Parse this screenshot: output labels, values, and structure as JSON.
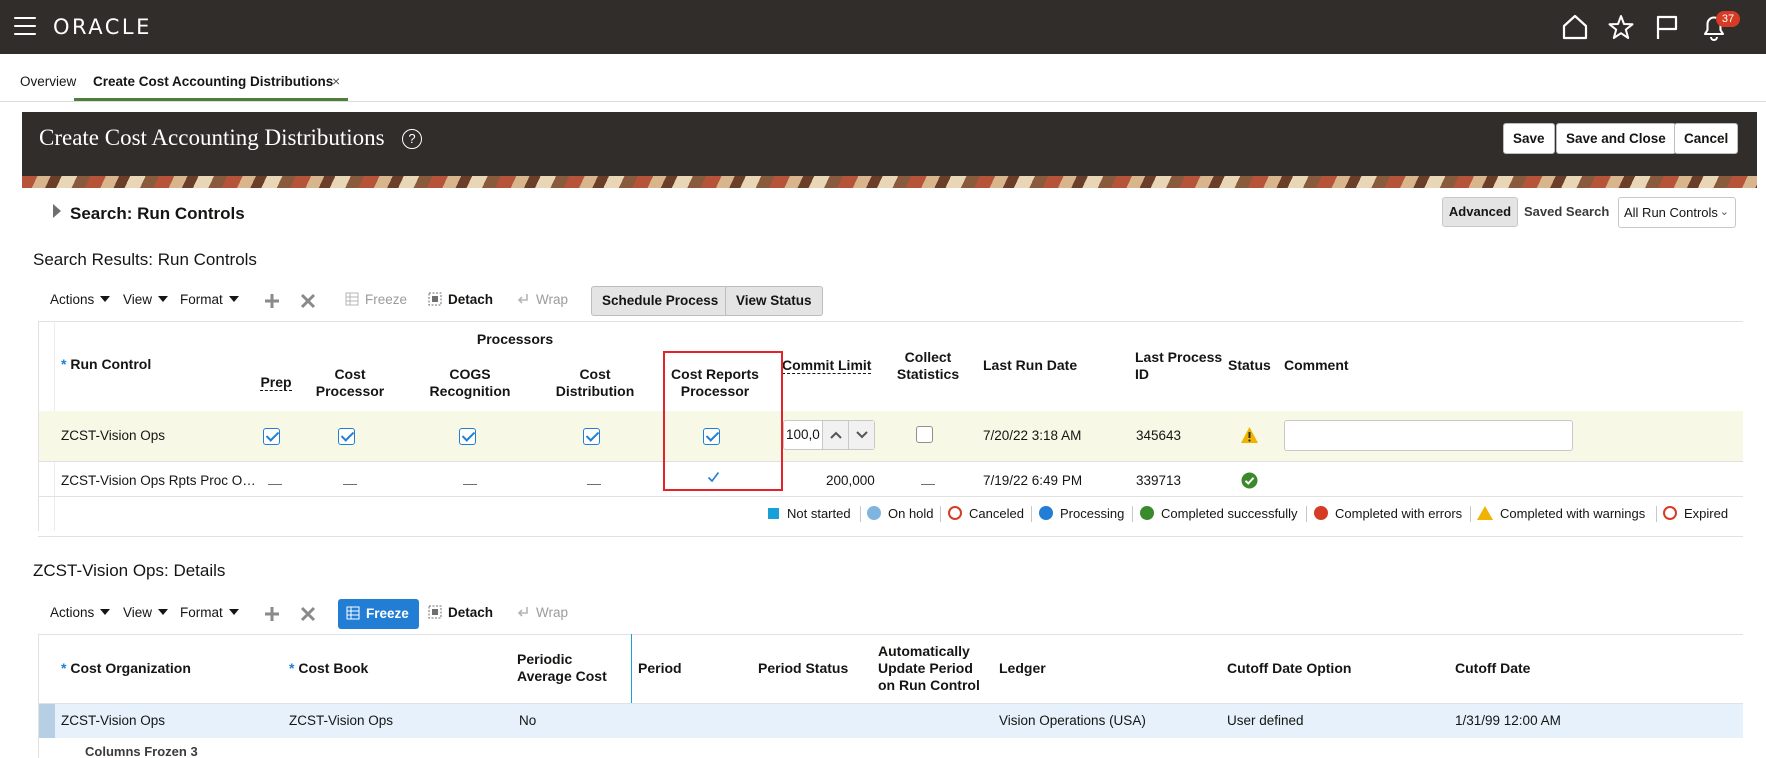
{
  "app": {
    "logo": "ORACLE",
    "notification_count": "37",
    "icons": [
      "home-icon",
      "favorites-icon",
      "watchlist-flag-icon",
      "notifications-bell-icon"
    ]
  },
  "tabs": [
    {
      "label": "Overview"
    },
    {
      "label": "Create Cost Accounting Distributions",
      "close": "×"
    }
  ],
  "header": {
    "title": "Create Cost Accounting Distributions",
    "help": "?",
    "save": "Save",
    "save_close": "Save and Close",
    "cancel": "Cancel"
  },
  "search": {
    "title": "Search: Run Controls",
    "advanced": "Advanced",
    "saved_search_label": "Saved Search",
    "saved_search_value": "All Run Controls"
  },
  "results": {
    "title": "Search Results: Run Controls",
    "toolbar": {
      "actions": "Actions",
      "view": "View",
      "format": "Format",
      "freeze": "Freeze",
      "detach": "Detach",
      "wrap": "Wrap",
      "schedule": "Schedule Process",
      "view_status": "View Status"
    },
    "columns": {
      "processors": "Processors",
      "run_control": "Run Control",
      "prep": "Prep",
      "cost_processor": "Cost Processor",
      "cogs": "COGS Recognition",
      "cost_distribution": "Cost Distribution",
      "cost_reports": "Cost Reports Processor",
      "commit_limit": "Commit Limit",
      "collect_stats": "Collect Statistics",
      "last_run_date": "Last Run Date",
      "last_process_id": "Last Process ID",
      "status": "Status",
      "comment": "Comment"
    },
    "rows": [
      {
        "run_control": "ZCST-Vision Ops",
        "prep": true,
        "cost_processor": true,
        "cogs": true,
        "cost_distribution": true,
        "cost_reports": true,
        "commit_limit": "100,0",
        "collect_stats": false,
        "last_run_date": "7/20/22 3:18 AM",
        "last_process_id": "345643",
        "status": "warning-icon",
        "comment": ""
      },
      {
        "run_control": "ZCST-Vision Ops Rpts Proc O…",
        "cost_reports": true,
        "commit_limit": "200,000",
        "last_run_date": "7/19/22 6:49 PM",
        "last_process_id": "339713",
        "status": "success-icon"
      }
    ],
    "legend": [
      {
        "label": "Not started",
        "color": "#1aa0d8"
      },
      {
        "label": "On hold",
        "color": "#7fb4e0"
      },
      {
        "label": "Canceled",
        "color": "#d63b25"
      },
      {
        "label": "Processing",
        "color": "#227ed4"
      },
      {
        "label": "Completed successfully",
        "color": "#3a8a2d"
      },
      {
        "label": "Completed with errors",
        "color": "#d63b25"
      },
      {
        "label": "Completed with warnings",
        "color": "#f0b400"
      },
      {
        "label": "Expired",
        "color": "#d63b25"
      }
    ]
  },
  "details": {
    "title": "ZCST-Vision Ops: Details",
    "toolbar": {
      "actions": "Actions",
      "view": "View",
      "format": "Format",
      "freeze": "Freeze",
      "detach": "Detach",
      "wrap": "Wrap"
    },
    "columns": {
      "cost_org": "Cost Organization",
      "cost_book": "Cost Book",
      "pac": "Periodic Average Cost",
      "period": "Period",
      "period_status": "Period Status",
      "auto_update": "Automatically Update Period on Run Control",
      "ledger": "Ledger",
      "cutoff_option": "Cutoff Date Option",
      "cutoff_date": "Cutoff Date"
    },
    "row": {
      "cost_org": "ZCST-Vision Ops",
      "cost_book": "ZCST-Vision Ops",
      "pac": "No",
      "ledger": "Vision Operations (USA)",
      "cutoff_option": "User defined",
      "cutoff_date": "1/31/99 12:00 AM"
    },
    "footer": "Columns Frozen",
    "frozen_count": "3"
  },
  "colors": {
    "topbar": "#312d2a",
    "accent": "#227ed4",
    "tab_underline": "#4e7e3a",
    "highlight_box": "#e3232a",
    "selected_row": "#f7f8e6",
    "details_row": "#e6f1fb"
  }
}
